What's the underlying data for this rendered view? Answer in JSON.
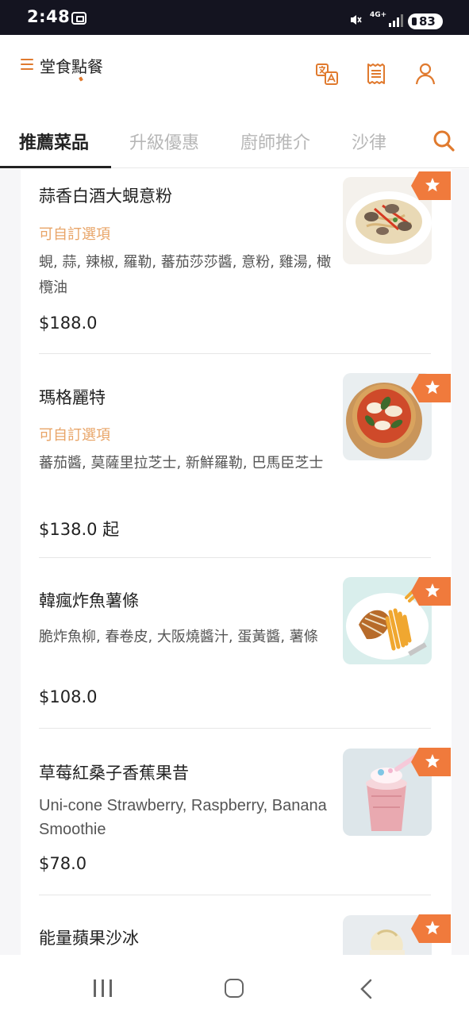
{
  "status_bar": {
    "time": "2:48",
    "network": "4G+",
    "battery": "83"
  },
  "header": {
    "title": "堂食點餐",
    "icons": [
      "translate-icon",
      "receipt-icon",
      "user-icon"
    ]
  },
  "tabs": [
    {
      "label": "推薦菜品",
      "active": true
    },
    {
      "label": "升級優惠",
      "active": false
    },
    {
      "label": "廚師推介",
      "active": false
    },
    {
      "label": "沙律",
      "active": false
    }
  ],
  "menu_items": [
    {
      "name": "蒜香白酒大蜆意粉",
      "custom": "可自訂選項",
      "description": "蜆, 蒜, 辣椒, 羅勒, 蕃茄莎莎醬, 意粉, 雞湯, 橄欖油",
      "price": "$188.0",
      "image": "clam-pasta"
    },
    {
      "name": "瑪格麗特",
      "custom": "可自訂選項",
      "description": "蕃茄醬, 莫薩里拉芝士, 新鮮羅勒, 巴馬臣芝士",
      "price": "$138.0 起",
      "image": "margherita-pizza"
    },
    {
      "name": "韓瘋炸魚薯條",
      "custom": "",
      "description": "脆炸魚柳, 春卷皮, 大阪燒醬汁, 蛋黃醬, 薯條",
      "price": "$108.0",
      "image": "fish-and-chips"
    },
    {
      "name": "草莓紅桑子香蕉果昔",
      "custom": "",
      "description": "Uni-cone Strawberry, Raspberry, Banana Smoothie",
      "price": "$78.0",
      "image": "strawberry-smoothie"
    },
    {
      "name": "能量蘋果沙冰",
      "custom": "",
      "description": "",
      "price": "",
      "image": "apple-smoothie"
    }
  ],
  "colors": {
    "accent": "#e07a2e",
    "custom_text": "#e8a467",
    "badge": "#f07a3c"
  }
}
